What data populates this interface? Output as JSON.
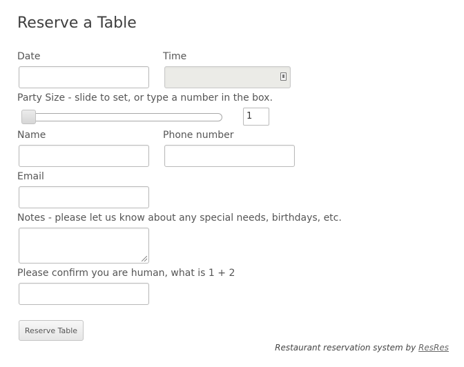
{
  "form": {
    "title": "Reserve a Table",
    "date": {
      "label": "Date",
      "value": ""
    },
    "time": {
      "label": "Time",
      "value": "",
      "icon": "clock-icon"
    },
    "party_size": {
      "label": "Party Size - slide to set, or type a number in the box.",
      "value": "1"
    },
    "name": {
      "label": "Name",
      "value": ""
    },
    "phone": {
      "label": "Phone number",
      "value": ""
    },
    "email": {
      "label": "Email",
      "value": ""
    },
    "notes": {
      "label": "Notes - please let us know about any special needs, birthdays, etc.",
      "value": ""
    },
    "captcha": {
      "label": "Please confirm you are human, what is 1 + 2",
      "value": ""
    },
    "submit_label": "Reserve Table"
  },
  "footer": {
    "text": "Restaurant reservation system by",
    "link_text": "ResRes"
  }
}
